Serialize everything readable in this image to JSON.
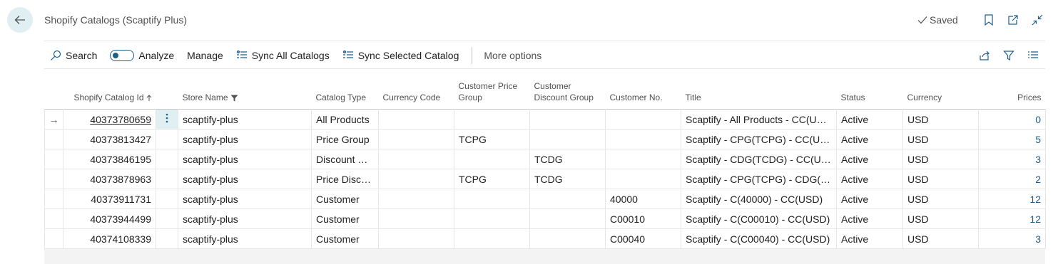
{
  "header": {
    "title": "Shopify Catalogs (Scaptify Plus)",
    "saved_label": "Saved"
  },
  "actions": {
    "search": "Search",
    "analyze": "Analyze",
    "manage": "Manage",
    "sync_all": "Sync All Catalogs",
    "sync_selected": "Sync Selected Catalog",
    "more_options": "More options"
  },
  "table": {
    "columns": {
      "id": "Shopify Catalog Id",
      "store": "Store Name",
      "type": "Catalog Type",
      "currency_code": "Currency Code",
      "cust_price_group": "Customer Price Group",
      "cust_discount_group": "Customer Discount Group",
      "cust_no": "Customer No.",
      "title": "Title",
      "status": "Status",
      "currency": "Currency",
      "prices": "Prices"
    },
    "rows": [
      {
        "id": "40373780659",
        "store": "scaptify-plus",
        "type": "All Products",
        "currency_code": "",
        "cpg": "",
        "cdg": "",
        "cust_no": "",
        "title": "Scaptify - All Products - CC(USD)",
        "status": "Active",
        "currency": "USD",
        "prices": "0"
      },
      {
        "id": "40373813427",
        "store": "scaptify-plus",
        "type": "Price Group",
        "currency_code": "",
        "cpg": "TCPG",
        "cdg": "",
        "cust_no": "",
        "title": "Scaptify - CPG(TCPG) - CC(USD)",
        "status": "Active",
        "currency": "USD",
        "prices": "5"
      },
      {
        "id": "40373846195",
        "store": "scaptify-plus",
        "type": "Discount Gr...",
        "currency_code": "",
        "cpg": "",
        "cdg": "TCDG",
        "cust_no": "",
        "title": "Scaptify - CDG(TCDG) - CC(USD)",
        "status": "Active",
        "currency": "USD",
        "prices": "3"
      },
      {
        "id": "40373878963",
        "store": "scaptify-plus",
        "type": "Price Disco...",
        "currency_code": "",
        "cpg": "TCPG",
        "cdg": "TCDG",
        "cust_no": "",
        "title": "Scaptify - CPG(TCPG) - CDG(TC...",
        "status": "Active",
        "currency": "USD",
        "prices": "2"
      },
      {
        "id": "40373911731",
        "store": "scaptify-plus",
        "type": "Customer",
        "currency_code": "",
        "cpg": "",
        "cdg": "",
        "cust_no": "40000",
        "title": "Scaptify - C(40000) - CC(USD)",
        "status": "Active",
        "currency": "USD",
        "prices": "12"
      },
      {
        "id": "40373944499",
        "store": "scaptify-plus",
        "type": "Customer",
        "currency_code": "",
        "cpg": "",
        "cdg": "",
        "cust_no": "C00010",
        "title": "Scaptify - C(C00010) - CC(USD)",
        "status": "Active",
        "currency": "USD",
        "prices": "12"
      },
      {
        "id": "40374108339",
        "store": "scaptify-plus",
        "type": "Customer",
        "currency_code": "",
        "cpg": "",
        "cdg": "",
        "cust_no": "C00040",
        "title": "Scaptify - C(C00040) - CC(USD)",
        "status": "Active",
        "currency": "USD",
        "prices": "3"
      }
    ]
  },
  "colors": {
    "accent": "#1e5f8a",
    "selection": "#dfeff2"
  }
}
